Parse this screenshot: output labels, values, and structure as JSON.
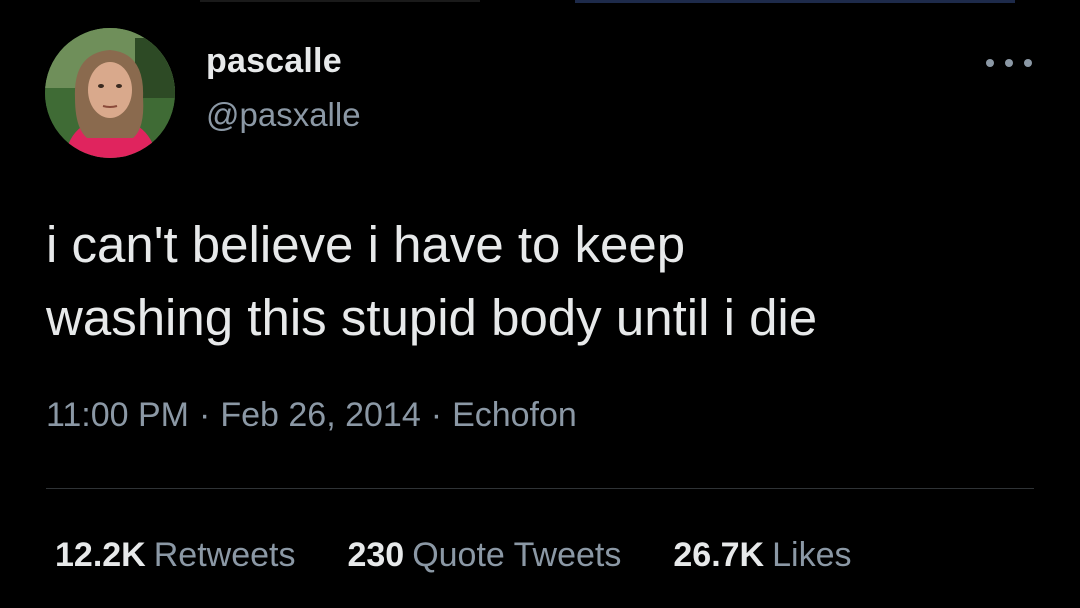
{
  "tweet": {
    "display_name": "pascalle",
    "handle": "@pasxalle",
    "text_line1": "i can't believe i have to keep",
    "text_line2": "washing this stupid body until i die",
    "time": "11:00 PM",
    "date": "Feb 26, 2014",
    "source": "Echofon",
    "separator": "·"
  },
  "stats": {
    "retweets_count": "12.2K",
    "retweets_label": "Retweets",
    "quotes_count": "230",
    "quotes_label": "Quote Tweets",
    "likes_count": "26.7K",
    "likes_label": "Likes"
  },
  "icons": {
    "more": "more-horizontal-icon",
    "avatar": "profile-photo"
  },
  "colors": {
    "background": "#000000",
    "primary_text": "#e7e9ea",
    "secondary_text": "#8b98a5",
    "divider": "#2f3336"
  }
}
